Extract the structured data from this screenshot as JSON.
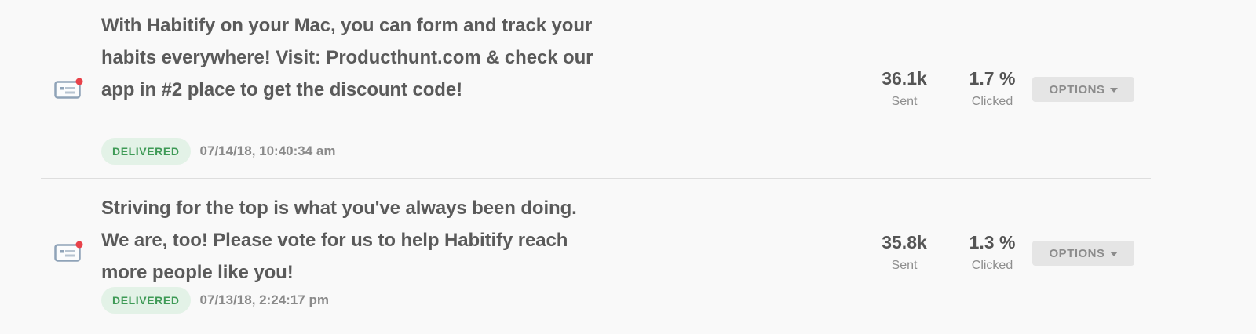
{
  "notifications": [
    {
      "icon": "notification-card-icon",
      "message": "With Habitify on your Mac, you can form and track your habits everywhere! Visit: Producthunt.com & check our app in #2 place to get the discount code!",
      "status": "DELIVERED",
      "timestamp": "07/14/18, 10:40:34 am",
      "sent_value": "36.1k",
      "sent_label": "Sent",
      "clicked_value": "1.7 %",
      "clicked_label": "Clicked",
      "options_label": "OPTIONS"
    },
    {
      "icon": "notification-card-icon",
      "message": "Striving for the top is what you've always been doing. We are, too! Please vote for us to help Habitify reach more people like you!",
      "status": "DELIVERED",
      "timestamp": "07/13/18, 2:24:17 pm",
      "sent_value": "35.8k",
      "sent_label": "Sent",
      "clicked_value": "1.3 %",
      "clicked_label": "Clicked",
      "options_label": "OPTIONS"
    }
  ],
  "colors": {
    "background": "#f9f9f9",
    "badge_bg": "#e3f2e7",
    "badge_text": "#3e9a56",
    "icon_stroke": "#8fa3b8",
    "icon_dot": "#e8424a",
    "options_bg": "#e5e5e5"
  }
}
